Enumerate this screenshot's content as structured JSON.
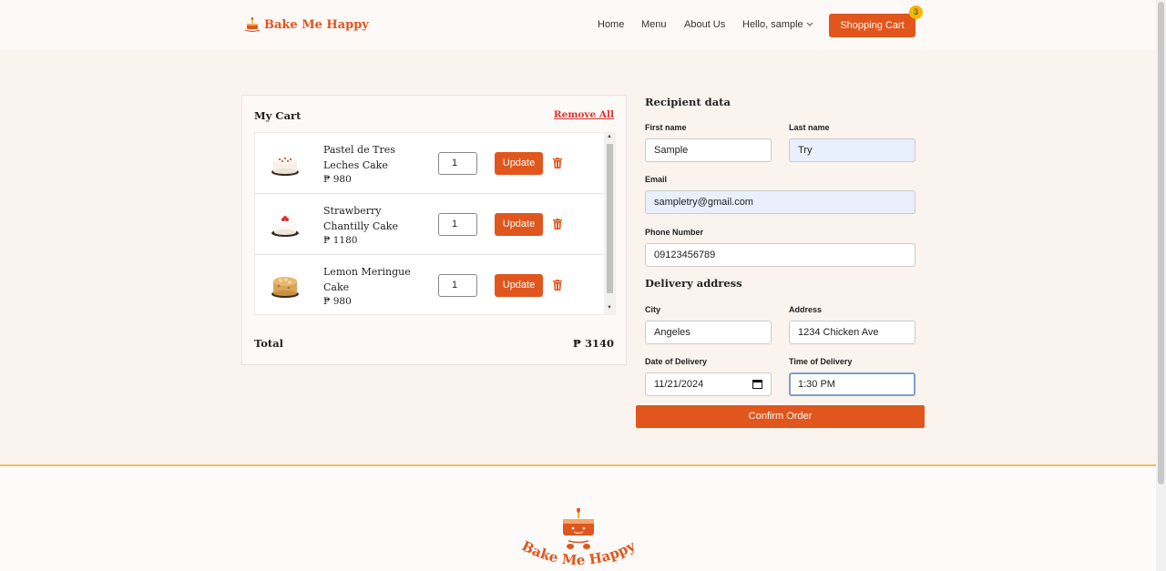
{
  "header": {
    "brand": "Bake Me Happy",
    "nav": {
      "home": "Home",
      "menu": "Menu",
      "about": "About Us",
      "greeting": "Hello, sample",
      "cart_button": "Shopping Cart",
      "cart_count": "3"
    }
  },
  "cart": {
    "title": "My Cart",
    "remove_all": "Remove All",
    "items": [
      {
        "name": "Pastel de Tres Leches Cake",
        "price": "₱ 980",
        "qty": "1",
        "update": "Update"
      },
      {
        "name": "Strawberry Chantilly Cake",
        "price": "₱ 1180",
        "qty": "1",
        "update": "Update"
      },
      {
        "name": "Lemon Meringue Cake",
        "price": "₱ 980",
        "qty": "1",
        "update": "Update"
      }
    ],
    "total_label": "Total",
    "total_value": "₱ 3140"
  },
  "form": {
    "recipient_title": "Recipient data",
    "first_name_label": "First name",
    "first_name": "Sample",
    "last_name_label": "Last name",
    "last_name": "Try",
    "email_label": "Email",
    "email": "sampletry@gmail.com",
    "phone_label": "Phone Number",
    "phone": "09123456789",
    "delivery_title": "Delivery address",
    "city_label": "City",
    "city": "Angeles",
    "address_label": "Address",
    "address": "1234 Chicken Ave",
    "date_label": "Date of Delivery",
    "date": "11/21/2024",
    "time_label": "Time of Delivery",
    "time": "1:30 PM",
    "confirm": "Confirm Order"
  },
  "footer": {
    "brand": "Bake Me Happy"
  },
  "colors": {
    "accent": "#e0561d",
    "badge": "#f5b800",
    "background": "#faf3ee",
    "autofill": "#e8f0fe",
    "footer_rule": "#e8c160"
  }
}
